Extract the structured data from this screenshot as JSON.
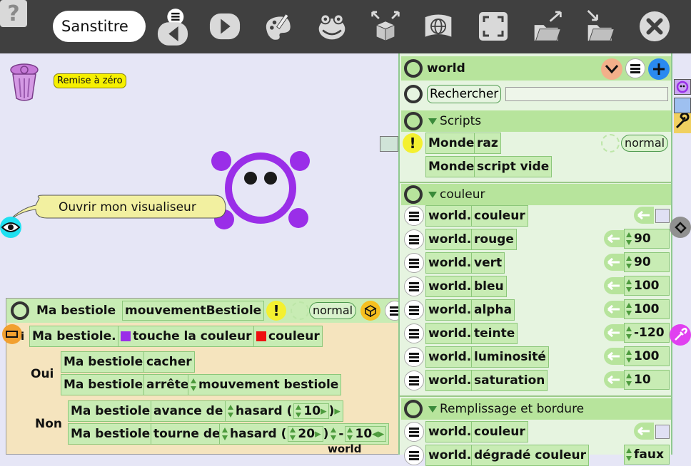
{
  "toolbar": {
    "help": "?",
    "title": "Sanstitre"
  },
  "stage": {
    "reset_label": "Remise à zéro",
    "bubble_text": "Ouvrir mon visualiseur"
  },
  "script": {
    "owner": "Ma bestiole",
    "name": "mouvementBestiole",
    "rate": "normal",
    "if_owner": "Ma bestiole.",
    "if_condition": "touche la couleur",
    "if_color_label": "couleur",
    "yes_label": "Oui",
    "no_label": "Non",
    "yes_rows": [
      {
        "owner": "Ma bestiole",
        "cmd": "cacher"
      },
      {
        "owner": "Ma bestiole",
        "cmd": "arrête",
        "arg": "mouvement bestiole"
      }
    ],
    "no_rows": [
      {
        "owner": "Ma bestiole",
        "cmd": "avance de",
        "fn": "hasard",
        "num": "10"
      },
      {
        "owner": "Ma bestiole",
        "cmd": "tourne de",
        "fn": "hasard",
        "num": "20",
        "op": "-",
        "num2": "10"
      }
    ],
    "footer_label": "world"
  },
  "viewer": {
    "title": "world",
    "search_label": "Rechercher",
    "search_value": "",
    "scripts_section": "Scripts",
    "script_rows": [
      {
        "owner": "Monde",
        "cmd": "raz",
        "rate": "normal"
      },
      {
        "owner": "Monde",
        "cmd": "script vide"
      }
    ],
    "color_section": "couleur",
    "color_rows": [
      {
        "owner": "world.",
        "prop": "couleur",
        "value": ""
      },
      {
        "owner": "world.",
        "prop": "rouge",
        "value": "90"
      },
      {
        "owner": "world.",
        "prop": "vert",
        "value": "90"
      },
      {
        "owner": "world.",
        "prop": "bleu",
        "value": "100"
      },
      {
        "owner": "world.",
        "prop": "alpha",
        "value": "100"
      },
      {
        "owner": "world.",
        "prop": "teinte",
        "value": "-120"
      },
      {
        "owner": "world.",
        "prop": "luminosité",
        "value": "100"
      },
      {
        "owner": "world.",
        "prop": "saturation",
        "value": "10"
      }
    ],
    "fill_section": "Remplissage et bordure",
    "fill_rows": [
      {
        "owner": "world.",
        "prop": "couleur",
        "value": ""
      },
      {
        "owner": "world.",
        "prop": "dégradé couleur",
        "value": "faux"
      }
    ]
  },
  "colors": {
    "toolbar_bg": "#404040",
    "stage_bg": "#e6e6f6",
    "tile_green": "#c8ecb4",
    "creature_purple": "#9a2ee8"
  }
}
